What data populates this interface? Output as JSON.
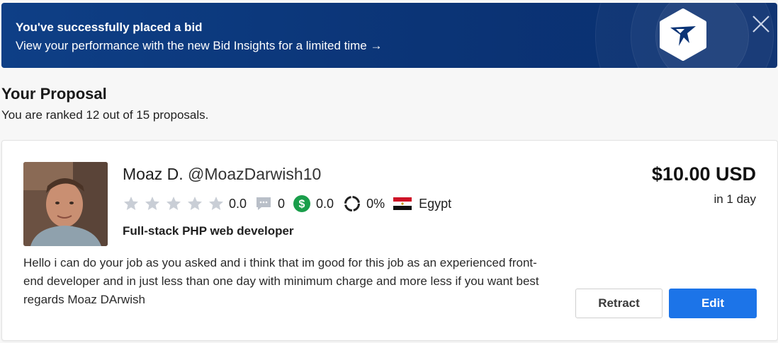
{
  "banner": {
    "title": "You've successfully placed a bid",
    "subtitle": "View your performance with the new Bid Insights for a limited time →",
    "logo_icon": "freelancer-bird-logo-icon",
    "close_icon": "close-icon",
    "background_color": "#0b3476"
  },
  "proposal": {
    "heading": "Your Proposal",
    "rank_text": "You are ranked 12 out of 15 proposals."
  },
  "bid": {
    "name": "Moaz D.",
    "username": "@MoazDarwish10",
    "rating": "0.0",
    "rating_stars": 0,
    "reviews": "0",
    "earnings": "0.0",
    "completion": "0%",
    "completion_fraction": 0,
    "country": "Egypt",
    "tagline": "Full-stack PHP web developer",
    "description": "Hello i can do your job as you asked and i think that im good for this job as an experienced front-end developer and in just less than one day with minimum charge and more less if you want best regards Moaz DArwish",
    "price": "$10.00 USD",
    "delivery": "in 1 day",
    "retract_label": "Retract",
    "edit_label": "Edit",
    "accent_color": "#1c74e8",
    "earnings_icon_color": "#1a9e4b"
  }
}
